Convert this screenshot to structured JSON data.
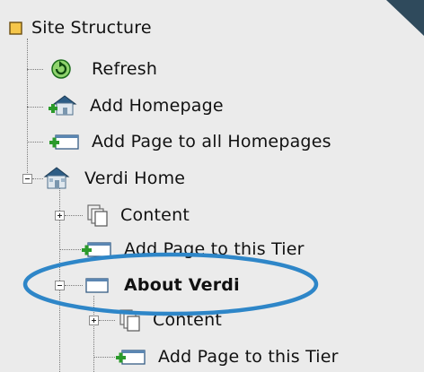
{
  "tree": {
    "root_label": "Site Structure",
    "items": [
      {
        "label": "Refresh",
        "icon": "refresh-icon"
      },
      {
        "label": "Add Homepage",
        "icon": "add-homepage-icon"
      },
      {
        "label": "Add Page to all Homepages",
        "icon": "add-page-icon"
      },
      {
        "label": "Verdi Home",
        "icon": "home-icon",
        "expanded": true
      },
      {
        "label": "Content",
        "icon": "content-pages-icon",
        "expanded": false
      },
      {
        "label": "Add Page to this Tier",
        "icon": "add-page-icon"
      },
      {
        "label": "About Verdi",
        "icon": "page-icon",
        "expanded": true,
        "bold": true
      },
      {
        "label": "Content",
        "icon": "content-pages-icon",
        "expanded": false
      },
      {
        "label": "Add Page to this Tier",
        "icon": "add-page-icon"
      }
    ]
  },
  "colors": {
    "background": "#ebebeb",
    "highlight_ellipse": "#2e86c8",
    "corner_decoration": "#2f4a5c"
  }
}
